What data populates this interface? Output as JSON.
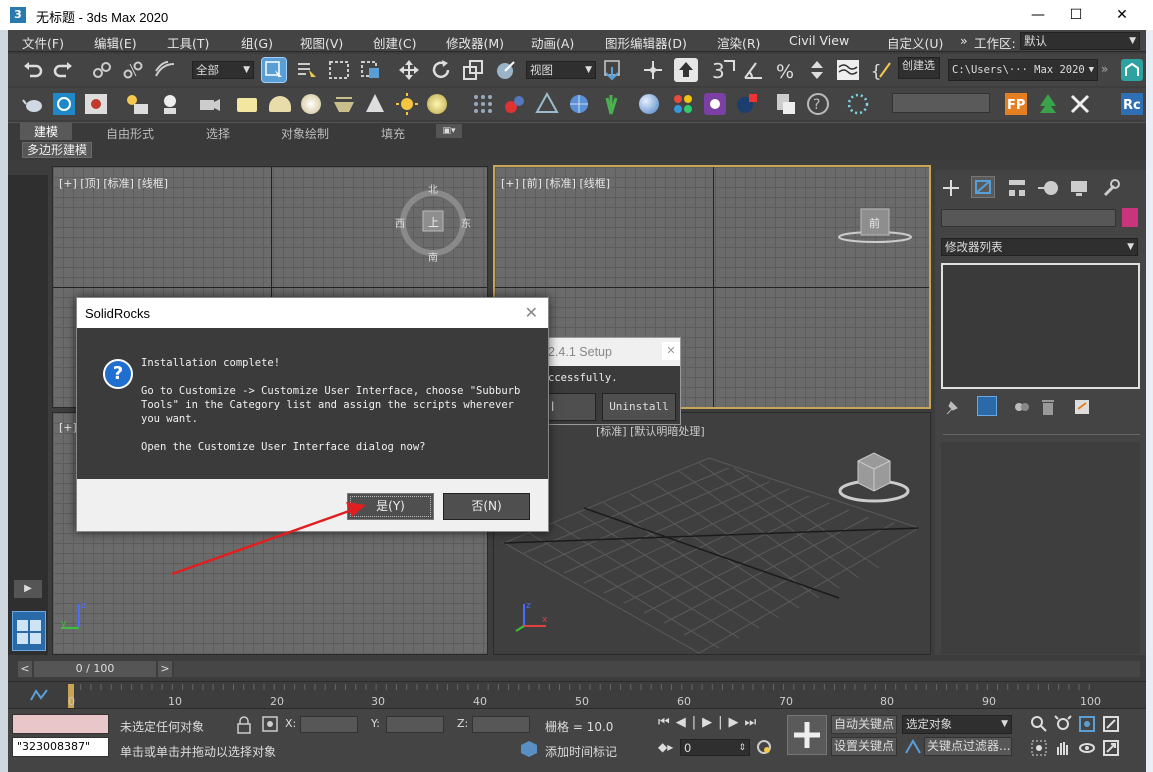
{
  "window": {
    "title": "无标题 - 3ds Max 2020",
    "app_icon_glyph": "3",
    "minimize": "—",
    "maximize": "☐",
    "close": "✕"
  },
  "menu": [
    "文件(F)",
    "编辑(E)",
    "工具(T)",
    "组(G)",
    "视图(V)",
    "创建(C)",
    "修改器(M)",
    "动画(A)",
    "图形编辑器(D)",
    "渲染(R)",
    "Civil View",
    "自定义(U)"
  ],
  "menu_more": "»",
  "workspace": {
    "label": "工作区:",
    "value": "默认"
  },
  "toolbar1": {
    "filter": "全部",
    "refcoord": "视图",
    "create_sel": "创建选",
    "path": "C:\\Users\\··· Max 2020",
    "snap_num": "3",
    "snap_sup": "2"
  },
  "ribbon": {
    "tabs": [
      "建模",
      "自由形式",
      "选择",
      "对象绘制",
      "填充"
    ],
    "poly": "多边形建模"
  },
  "viewports": {
    "top": "[+] [顶] [标准] [线框]",
    "front": "[+] [前] [标准] [线框]",
    "left": "[+]",
    "persp_partial": "[标准] [默认明暗处理]",
    "compass": {
      "n": "北",
      "s": "南",
      "e": "东",
      "w": "西",
      "center": "上"
    },
    "cube_front": "前"
  },
  "command_panel": {
    "modifier_list": "修改器列表"
  },
  "timeline": {
    "frame": "0 / 100",
    "prev": "<",
    "next": ">",
    "ticks": [
      "0",
      "10",
      "20",
      "30",
      "40",
      "50",
      "60",
      "70",
      "80",
      "90",
      "100"
    ]
  },
  "status": {
    "sel_text": "未选定任何对象",
    "hint": "单击或单击并拖动以选择对象",
    "script_id": "\"323008387\"",
    "x": "X:",
    "y": "Y:",
    "z": "Z:",
    "grid": "栅格 = 10.0",
    "add_time_tag": "添加时间标记",
    "auto_key": "自动关键点",
    "set_key": "设置关键点",
    "selected": "选定对象",
    "key_filter": "关键点过滤器...",
    "frame_spin": "0"
  },
  "dialog": {
    "title": "SolidRocks",
    "close": "✕",
    "icon": "?",
    "line1": "Installation complete!",
    "line2": "Go to Customize -> Customize User Interface, choose \"Subburb",
    "line3": "Tools\" in the Category list and assign the scripts wherever",
    "line4": "you want.",
    "line5": "Open the Customize User Interface dialog now?",
    "yes": "是(Y)",
    "no": "否(N)"
  },
  "setup_window": {
    "title": "2.4.1 Setup",
    "close": "✕",
    "text": "ccessfully.",
    "left_btn": "l",
    "uninstall": "Uninstall"
  },
  "colors": {
    "accent": "#5a9ed6",
    "annotation_arrow": "#e02020",
    "active_border": "#c8a455"
  }
}
